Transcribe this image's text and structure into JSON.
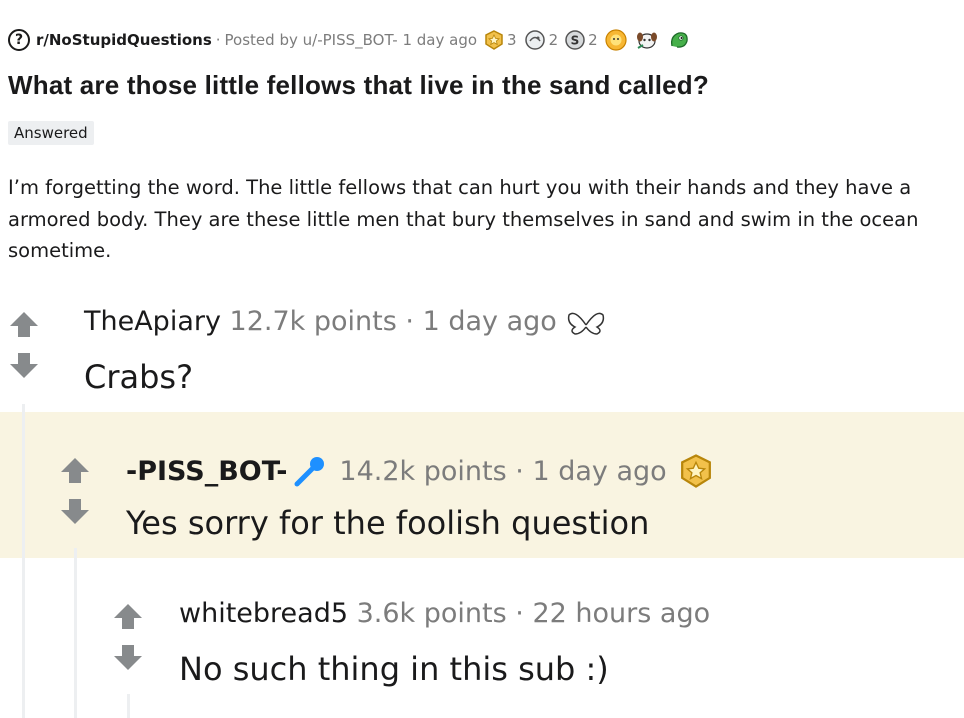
{
  "post": {
    "subreddit": "r/NoStupidQuestions",
    "posted_by_prefix": "Posted by",
    "author": "u/-PISS_BOT-",
    "age": "1 day ago",
    "awards": [
      {
        "icon": "gold-award-icon",
        "count": "3"
      },
      {
        "icon": "rocket-like-award-icon",
        "count": "2"
      },
      {
        "icon": "silver-coin-award-icon",
        "count": "2"
      },
      {
        "icon": "sun-award-icon",
        "count": ""
      },
      {
        "icon": "doggo-award-icon",
        "count": ""
      },
      {
        "icon": "green-award-icon",
        "count": ""
      }
    ],
    "title": "What are those little fellows that live in the sand called?",
    "flair": "Answered",
    "body": "I’m forgetting the word. The little fellows that can hurt you with their hands and they have a armored body. They are these little men that bury themselves in sand and swim in the ocean sometime."
  },
  "comments": [
    {
      "author": "TheApiary",
      "points": "12.7k points",
      "sep": "·",
      "age": "1 day ago",
      "award_icon": "wings-award-icon",
      "body": "Crabs?"
    },
    {
      "author": "-PISS_BOT-",
      "flair_icon": "microphone-icon",
      "points": "14.2k points",
      "sep": "·",
      "age": "1 day ago",
      "award_icon": "gold-award-icon",
      "body": "Yes sorry for the foolish question"
    },
    {
      "author": "whitebread5",
      "points": "3.6k points",
      "sep": "·",
      "age": "22 hours ago",
      "body": "No such thing in this sub :)"
    }
  ],
  "colors": {
    "highlight": "#f9f4e1",
    "gold": "#f2c14b",
    "arrow": "#878a8c",
    "mic": "#1e90ff"
  }
}
